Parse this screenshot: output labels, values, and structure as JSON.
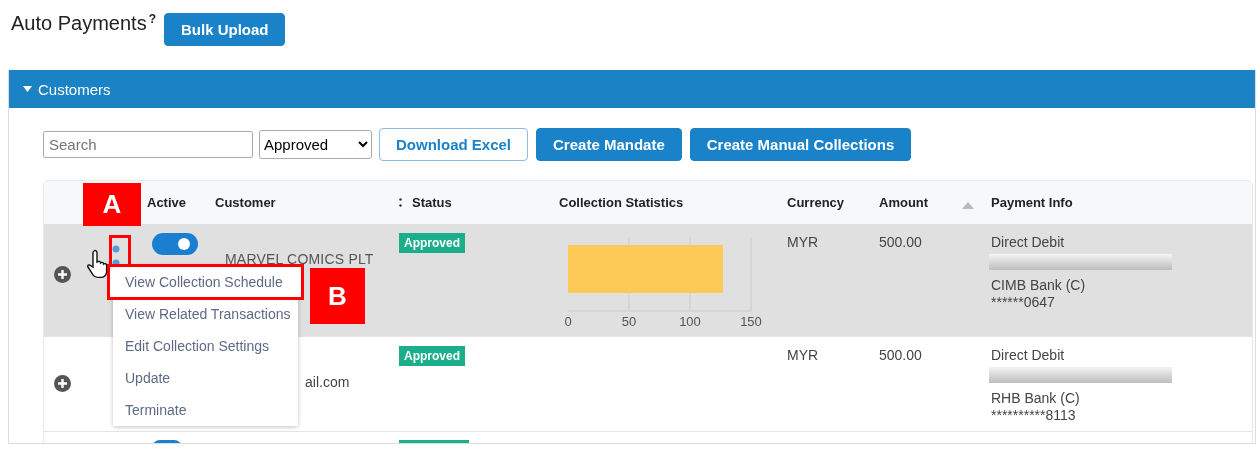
{
  "page": {
    "title": "Auto Payments",
    "help_mark": "?",
    "bulk_button": "Bulk Upload"
  },
  "panel": {
    "title": "Customers",
    "expanded": true
  },
  "toolbar": {
    "search_placeholder": "Search",
    "status_filter": "Approved",
    "buttons": [
      {
        "label": "Download Excel",
        "kind": "outline"
      },
      {
        "label": "Create Mandate",
        "kind": "solid"
      },
      {
        "label": "Create Manual Collections",
        "kind": "solid"
      }
    ]
  },
  "table": {
    "columns": [
      "Active",
      "Customer",
      "Status",
      "Collection Statistics",
      "Currency",
      "Amount",
      "Payment Info"
    ],
    "rows": [
      {
        "kind": "full",
        "selected": true,
        "active": true,
        "customer": "MARVEL COMICS PLT",
        "status": "Approved",
        "currency": "MYR",
        "amount": "500.00",
        "payment_method": "Direct Debit",
        "bank": "CIMB Bank (C)",
        "account": "******0647",
        "chart_data": {
          "type": "bar",
          "orientation": "horizontal",
          "values": [
            127
          ],
          "xlim": [
            0,
            150
          ],
          "xticks": [
            0,
            50,
            100,
            150
          ]
        }
      },
      {
        "kind": "full",
        "selected": false,
        "email_part": "ail.com",
        "status": "Approved",
        "currency": "MYR",
        "amount": "500.00",
        "payment_method": "Direct Debit",
        "bank": "RHB Bank (C)",
        "account": "**********8113"
      },
      {
        "kind": "cut-off",
        "selected": false,
        "active": true
      }
    ]
  },
  "row_menu": {
    "items": [
      {
        "label": "View Collection Schedule",
        "selected": true
      },
      {
        "label": "View Related Transactions",
        "selected": false
      },
      {
        "label": "Edit Collection Settings",
        "selected": false
      },
      {
        "label": "Update",
        "selected": false
      },
      {
        "label": "Terminate",
        "selected": false
      }
    ]
  },
  "annotations": [
    {
      "label": "A"
    },
    {
      "label": "B"
    }
  ]
}
